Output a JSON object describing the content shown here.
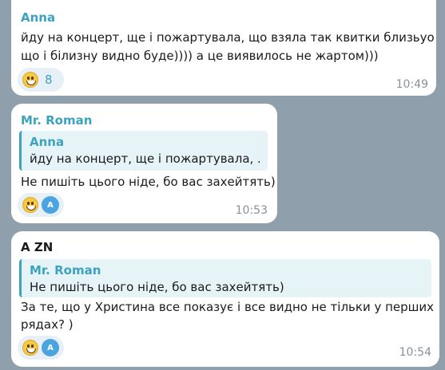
{
  "messages": [
    {
      "sender": "Anna",
      "sender_color": "#3ca3bf",
      "lines": [
        "йду на концерт, ще і пожартувала, що взяла так квитки близьуо",
        "що і білизну видно буде)))) а це виявилось не жартом)))"
      ],
      "reaction": {
        "emoji": "grinning-face",
        "count": "8"
      },
      "time": "10:49"
    },
    {
      "sender": "Mr. Roman",
      "sender_color": "#3ca3bf",
      "reply": {
        "name": "Anna",
        "text": "йду на концерт, ще і пожартувала, ..."
      },
      "text": "Не пишіть цього ніде, бо вас захейтять)",
      "reaction": {
        "emoji": "grinning-face",
        "avatar": "A"
      },
      "time": "10:53"
    },
    {
      "sender": "A ZN",
      "sender_color": "#1b1b1b",
      "reply": {
        "name": "Mr. Roman",
        "text": "Не пишіть цього ніде, бо вас захейтять)"
      },
      "lines": [
        "За те, що у Христина все показує і все видно не тільки у перших",
        "рядах? )"
      ],
      "reaction": {
        "emoji": "grinning-face",
        "avatar": "A"
      },
      "time": "10:54"
    }
  ],
  "colors": {
    "background": "#8fa0ac",
    "accent": "#3ca3bf",
    "bubble": "#ffffff"
  }
}
